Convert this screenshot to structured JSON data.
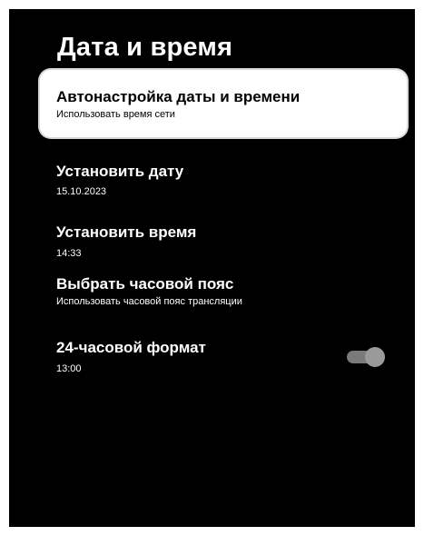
{
  "page": {
    "title": "Дата и время"
  },
  "settings": [
    {
      "label": "Автонастройка даты и времени",
      "value": "Использовать время сети",
      "selected": true
    },
    {
      "label": "Установить дату",
      "value": "15.10.2023"
    },
    {
      "label": "Установить время",
      "value": "14:33"
    },
    {
      "label": "Выбрать часовой пояс",
      "value": "Использовать часовой пояс трансляции"
    },
    {
      "label": "24-часовой формат",
      "value": "13:00",
      "toggle_on": true
    }
  ],
  "colors": {
    "background": "#000000",
    "text": "#ffffff",
    "selected_bg": "#ffffff",
    "selected_text": "#000000",
    "toggle_track": "#7a7a7a",
    "toggle_knob": "#9a9a9a"
  }
}
